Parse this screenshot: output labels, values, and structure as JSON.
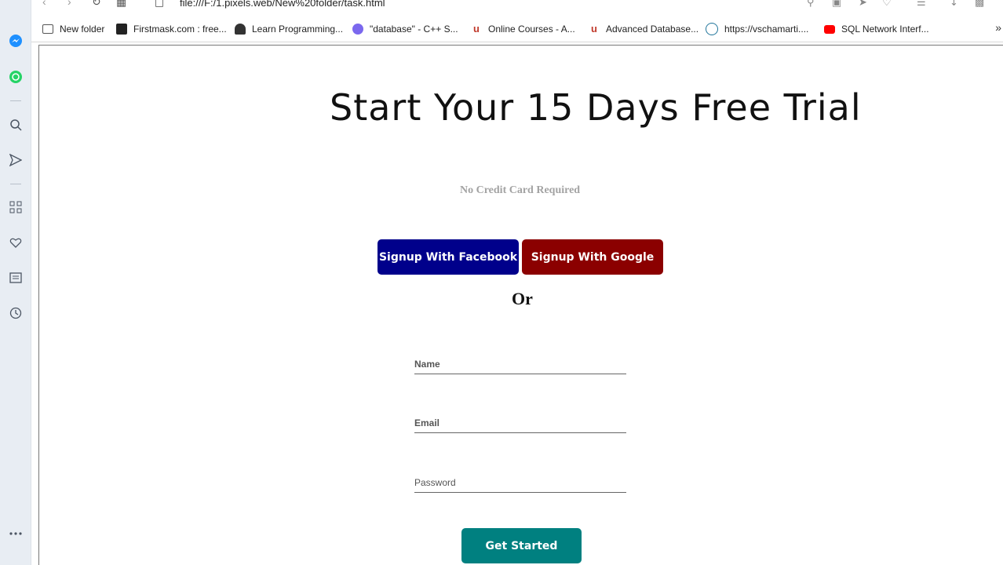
{
  "browser": {
    "url": "file:///F:/1.pixels.web/New%20folder/task.html",
    "bookmarks": [
      {
        "label": "New folder",
        "icon": "folder-icon",
        "color": "#555555"
      },
      {
        "label": "Firstmask.com : free...",
        "icon": "firstmask-icon",
        "color": "#222222"
      },
      {
        "label": "Learn Programming...",
        "icon": "learn-programming-icon",
        "color": "#333333"
      },
      {
        "label": "\"database\" - C++ S...",
        "icon": "cplusplus-icon",
        "color": "#6a5acd"
      },
      {
        "label": "Online Courses - A...",
        "icon": "udemy-icon",
        "color": "#c0392b"
      },
      {
        "label": "Advanced Database...",
        "icon": "udemy-icon",
        "color": "#c0392b"
      },
      {
        "label": "https://vschamarti....",
        "icon": "wordpress-icon",
        "color": "#21759b"
      },
      {
        "label": "SQL Network Interf...",
        "icon": "youtube-icon",
        "color": "#ff0000"
      }
    ]
  },
  "sidebar": {
    "items": [
      {
        "icon": "messenger-icon"
      },
      {
        "icon": "whatsapp-icon"
      },
      {
        "icon": "search-icon"
      },
      {
        "icon": "send-icon"
      },
      {
        "icon": "apps-grid-icon"
      },
      {
        "icon": "heart-icon"
      },
      {
        "icon": "news-icon"
      },
      {
        "icon": "history-clock-icon"
      },
      {
        "icon": "more-icon"
      }
    ]
  },
  "page": {
    "title": "Start Your 15 Days Free Trial",
    "subtitle": "No Credit Card Required",
    "facebook_button": "Signup With Facebook",
    "google_button": "Signup With Google",
    "or_text": "Or",
    "name_placeholder": "Name",
    "email_placeholder": "Email",
    "password_placeholder": "Password",
    "cta_button": "Get Started",
    "colors": {
      "facebook": "#00008b",
      "google": "#8b0000",
      "cta": "#008080"
    }
  }
}
